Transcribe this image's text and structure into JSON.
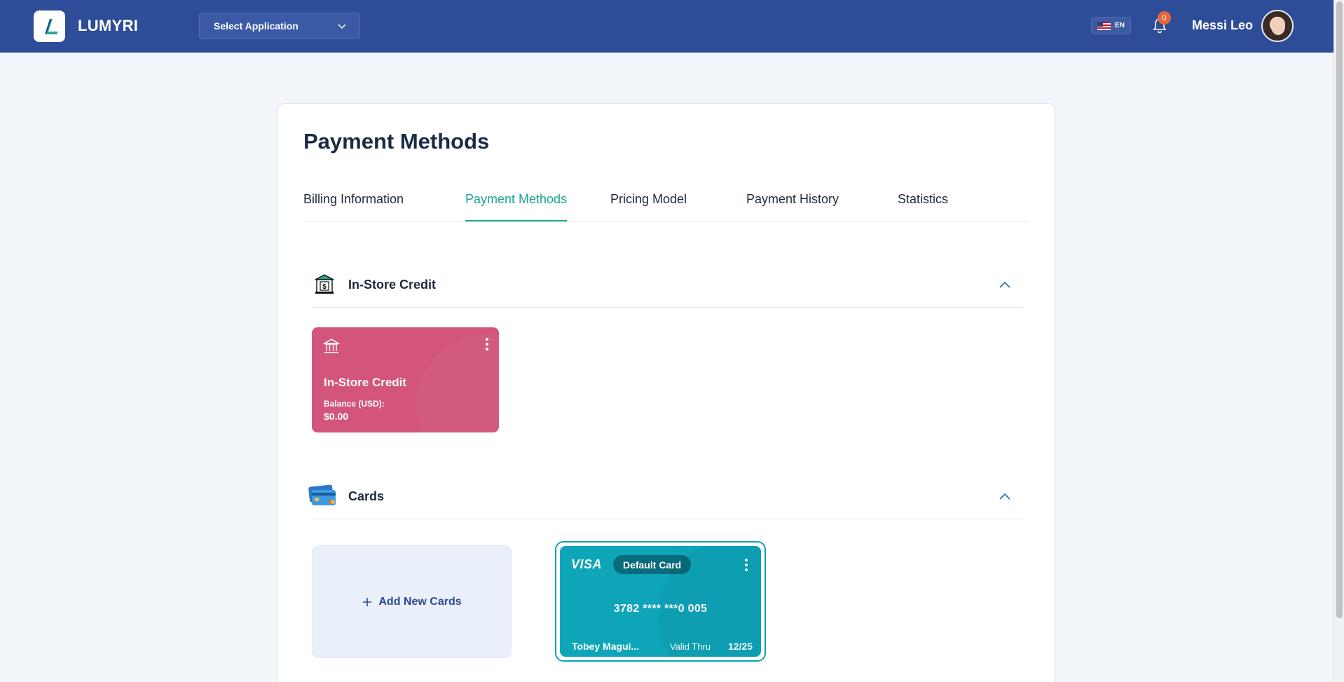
{
  "header": {
    "brand": "LUMYRI",
    "app_select": "Select Application",
    "language": "EN",
    "notification_count": "0",
    "user_name": "Messi Leo"
  },
  "page": {
    "title": "Payment Methods",
    "tabs": [
      {
        "label": "Billing Information"
      },
      {
        "label": "Payment Methods"
      },
      {
        "label": "Pricing Model"
      },
      {
        "label": "Payment History"
      },
      {
        "label": "Statistics"
      }
    ],
    "active_tab": "Payment Methods"
  },
  "in_store_credit": {
    "section_title": "In-Store Credit",
    "card": {
      "title": "In-Store Credit",
      "balance_label": "Balance (USD):",
      "balance": "$0.00",
      "color": "#d3557b"
    }
  },
  "cards": {
    "section_title": "Cards",
    "add_label": "Add New Cards",
    "items": [
      {
        "brand": "VISA",
        "badge": "Default Card",
        "number": "3782 **** ***0 005",
        "holder": "Tobey Magui...",
        "valid_label": "Valid Thru",
        "valid": "12/25",
        "color": "#0ea5b9"
      }
    ]
  },
  "colors": {
    "header_bg": "#2e4d98",
    "accent": "#1aa58b",
    "page_bg": "#f2f5f9"
  }
}
